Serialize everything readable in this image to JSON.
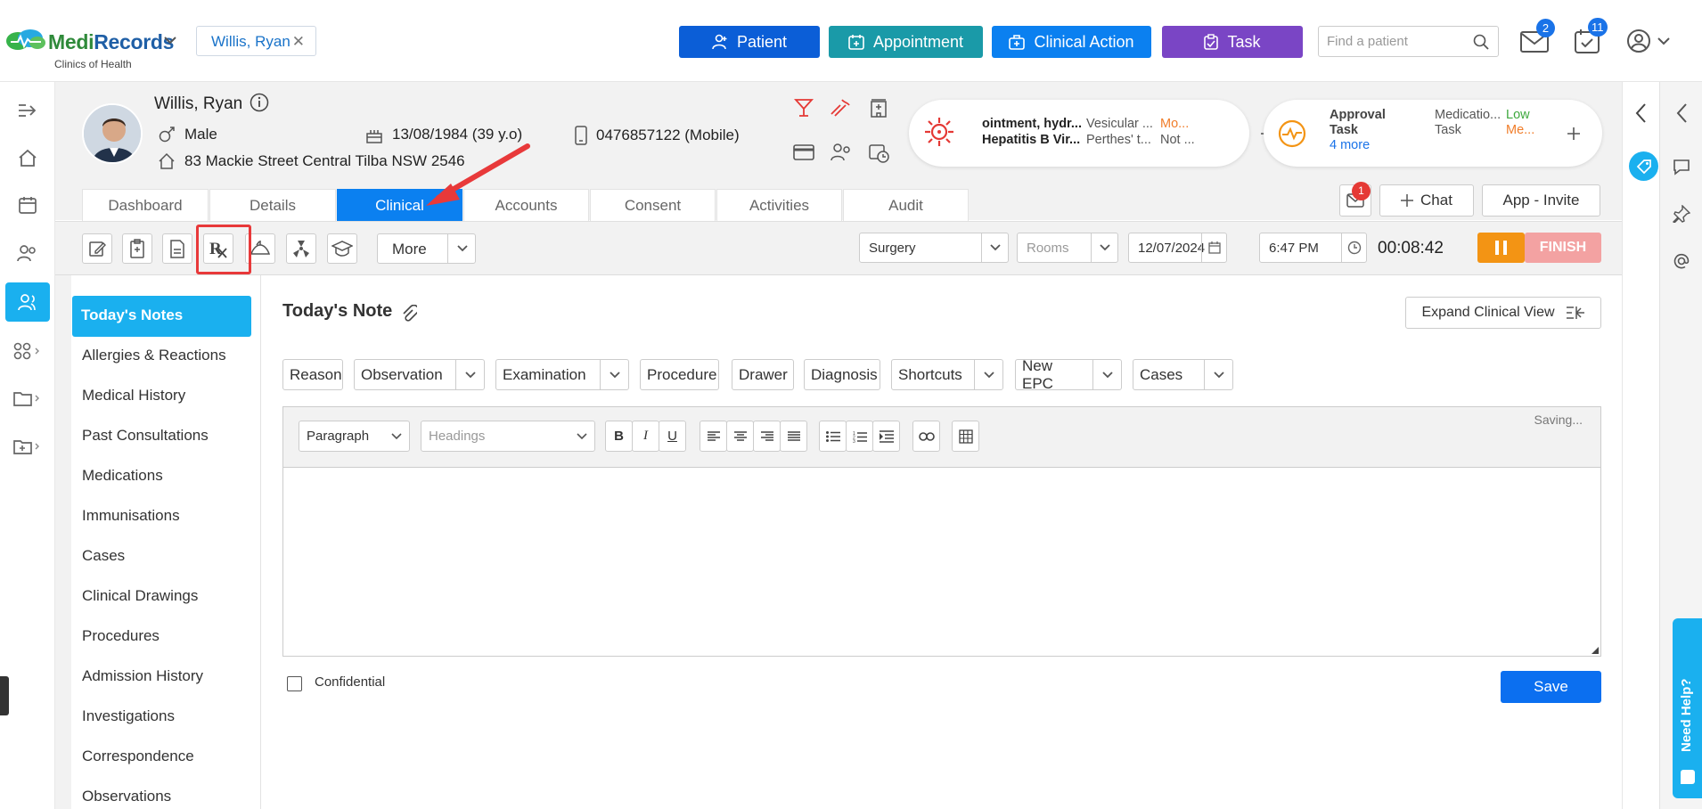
{
  "app": {
    "brand_a": "Medi",
    "brand_b": "Records",
    "subtitle": "Clinics of Health"
  },
  "patient_tab": {
    "label": "Willis, Ryan"
  },
  "top_buttons": {
    "patient": "Patient",
    "appointment": "Appointment",
    "clinical_action": "Clinical Action",
    "task": "Task"
  },
  "colors": {
    "patient": "#0b5ed7",
    "appointment": "#1a9aa8",
    "clinical_action": "#0b80f0",
    "task": "#7a45c5",
    "accent": "#1ab0ef",
    "finish": "#f3a2a2",
    "pause": "#f39414"
  },
  "search": {
    "placeholder": "Find a patient"
  },
  "badges": {
    "mail": "2",
    "calendar": "11",
    "chat_mail": "1"
  },
  "patient": {
    "name": "Willis, Ryan",
    "gender": "Male",
    "dob": "13/08/1984 (39 y.o)",
    "phone": "0476857122 (Mobile)",
    "address": "83 Mackie Street Central Tilba NSW 2546"
  },
  "allergy_card": {
    "a1": "ointment, hydr...",
    "a2": "Vesicular ...",
    "a3": "Mo...",
    "b1": "Hepatitis B Vir...",
    "b2": "Perthes' t...",
    "b3": "Not ..."
  },
  "task_card": {
    "t1": "Approval",
    "t2": "Task",
    "more": "4 more",
    "m1": "Medicatio...",
    "m2": "Task",
    "p1": "Low",
    "p2": "Me..."
  },
  "tabs": [
    "Dashboard",
    "Details",
    "Clinical",
    "Accounts",
    "Consent",
    "Activities",
    "Audit"
  ],
  "actions": {
    "chat": "Chat",
    "invite": "App - Invite"
  },
  "toolbar": {
    "more": "More",
    "surgery": "Surgery",
    "rooms": "Rooms",
    "date": "12/07/2024",
    "time": "6:47 PM",
    "timer": "00:08:42",
    "finish": "FINISH"
  },
  "nav": [
    "Today's Notes",
    "Allergies & Reactions",
    "Medical History",
    "Past Consultations",
    "Medications",
    "Immunisations",
    "Cases",
    "Clinical Drawings",
    "Procedures",
    "Admission History",
    "Investigations",
    "Correspondence",
    "Observations"
  ],
  "main": {
    "title": "Today's Note",
    "expand": "Expand Clinical View",
    "saving": "Saving...",
    "confidential": "Confidential",
    "save": "Save"
  },
  "pills": [
    "Reason",
    "Observation",
    "Examination",
    "Procedure",
    "Drawer",
    "Diagnosis",
    "Shortcuts",
    "New EPC",
    "Cases"
  ],
  "editor": {
    "paragraph": "Paragraph",
    "headings": "Headings",
    "bold": "B",
    "italic": "I",
    "underline": "U"
  },
  "help": {
    "label": "Need Help?"
  }
}
